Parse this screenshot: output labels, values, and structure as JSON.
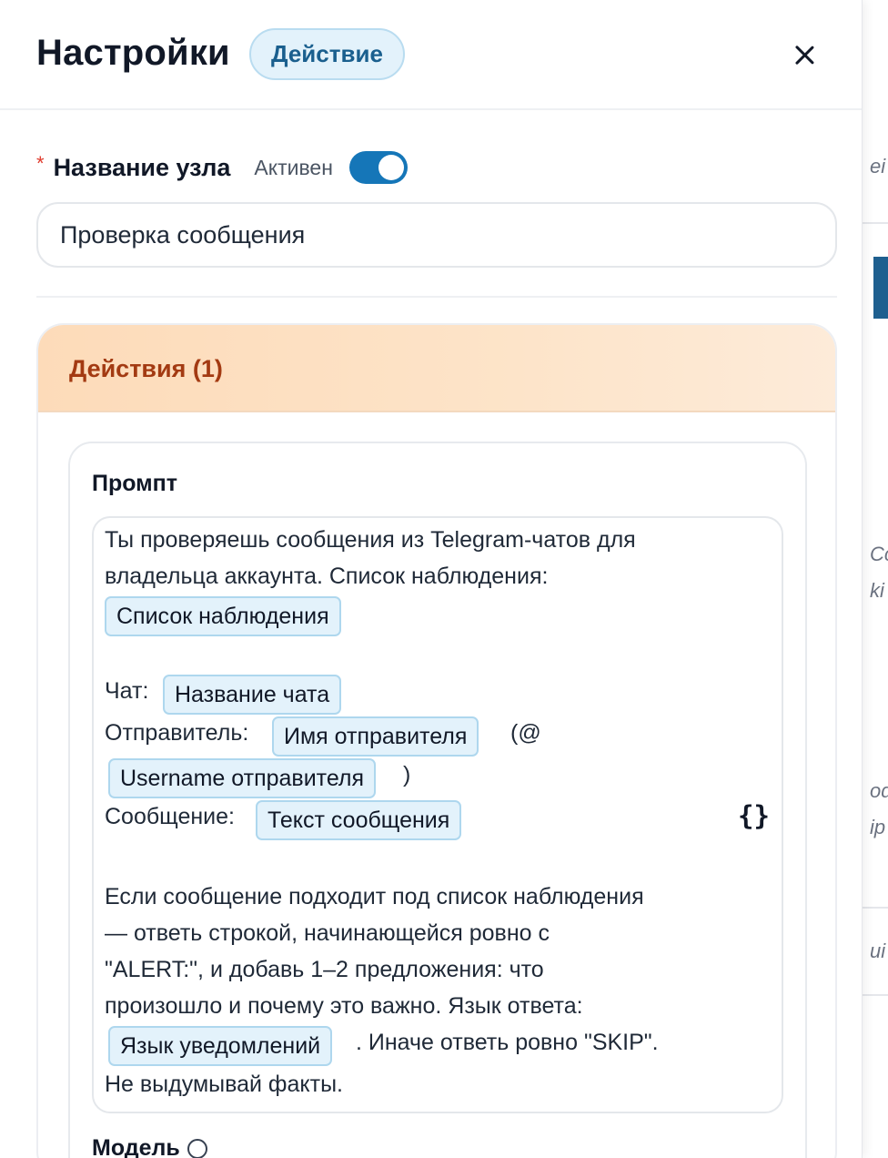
{
  "header": {
    "title": "Настройки",
    "badge": "Действие"
  },
  "node": {
    "name_label": "Название узла",
    "active_label": "Активен",
    "active": true,
    "name_value": "Проверка сообщения"
  },
  "actions": {
    "title": "Действия (1)",
    "prompt_label": "Промпт",
    "prompt": {
      "l1": "Ты проверяешь сообщения из Telegram-чатов для",
      "l2": "владельца аккаунта. Список наблюдения:",
      "chip_watchlist": "Список наблюдения",
      "chat_label": "Чат:",
      "chip_chat": "Название чата",
      "sender_label": "Отправитель:",
      "chip_sender": "Имя отправителя",
      "at_open": "(@",
      "chip_username": "Username отправителя",
      "at_close": ")",
      "message_label": "Сообщение:",
      "chip_message": "Текст сообщения",
      "p1": "Если сообщение подходит под список наблюдения",
      "p2": "— ответь строкой, начинающейся ровно с",
      "p3": "\"ALERT:\", и добавь 1–2 предложения: что",
      "p4": "произошло и почему это важно. Язык ответа:",
      "chip_lang": "Язык уведомлений",
      "p5_tail": ". Иначе ответь ровно \"SKIP\".",
      "p6": "Не выдумывай факты."
    },
    "variables_icon": "{}",
    "model_label": "Модель"
  },
  "background": {
    "frag1": "ei",
    "frag2": "Cc",
    "frag3": "ki",
    "frag4": "od",
    "frag5": "ip",
    "frag6": "ui"
  },
  "colors": {
    "accent": "#1576b8",
    "badge_bg": "#e3f2fb",
    "actions_header": "#fddbb9",
    "actions_title": "#a33a12",
    "required": "#e03b2d"
  }
}
